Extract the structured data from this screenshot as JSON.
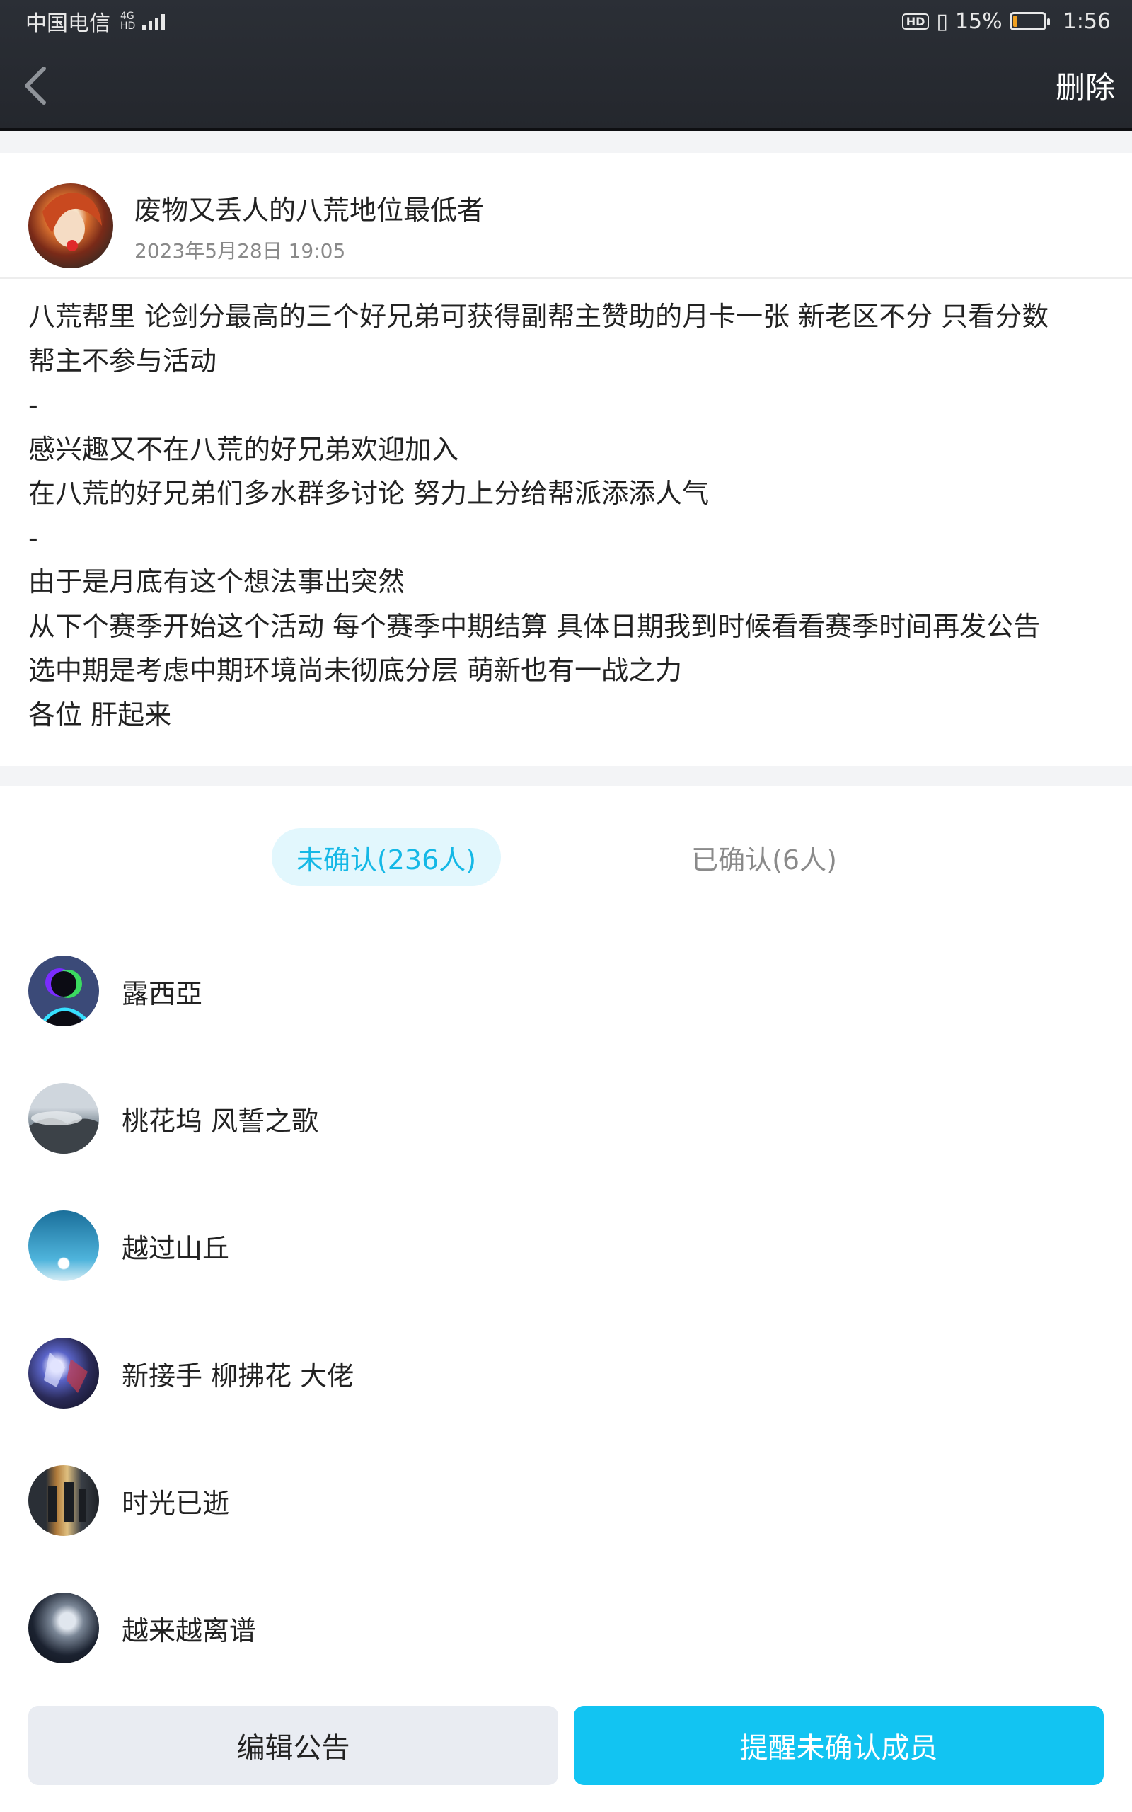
{
  "status_bar": {
    "carrier": "中国电信",
    "network_top": "4G",
    "network_bottom": "HD",
    "hd_badge": "HD",
    "battery_percent_text": "15%",
    "battery_level": 0.15,
    "time": "1:56",
    "icons": [
      "signal-icon",
      "vibrate-icon",
      "battery-icon"
    ]
  },
  "header": {
    "back_icon": "chevron-left-icon",
    "delete_label": "删除"
  },
  "announcement": {
    "author_name": "废物又丢人的八荒地位最低者",
    "timestamp": "2023年5月28日 19:05",
    "lines": [
      "八荒帮里 论剑分最高的三个好兄弟可获得副帮主赞助的月卡一张 新老区不分 只看分数",
      "帮主不参与活动",
      "-",
      "感兴趣又不在八荒的好兄弟欢迎加入",
      "在八荒的好兄弟们多水群多讨论 努力上分给帮派添添人气",
      "-",
      "由于是月底有这个想法事出突然",
      "从下个赛季开始这个活动 每个赛季中期结算 具体日期我到时候看看赛季时间再发公告",
      "选中期是考虑中期环境尚未彻底分层 萌新也有一战之力",
      "各位 肝起来"
    ]
  },
  "tabs": {
    "unconfirmed": "未确认(236人)",
    "confirmed": "已确认(6人)"
  },
  "members": [
    {
      "name": "露西亞"
    },
    {
      "name": "桃花坞 风誓之歌"
    },
    {
      "name": "越过山丘"
    },
    {
      "name": "新接手 柳拂花 大佬"
    },
    {
      "name": "时光已逝"
    },
    {
      "name": "越来越离谱"
    }
  ],
  "buttons": {
    "edit": "编辑公告",
    "remind": "提醒未确认成员"
  },
  "colors": {
    "accent": "#12c4f2",
    "tab_active_bg": "#e2f7fd",
    "header_bg": "#2b2f36",
    "battery_fill": "#f0a020"
  }
}
